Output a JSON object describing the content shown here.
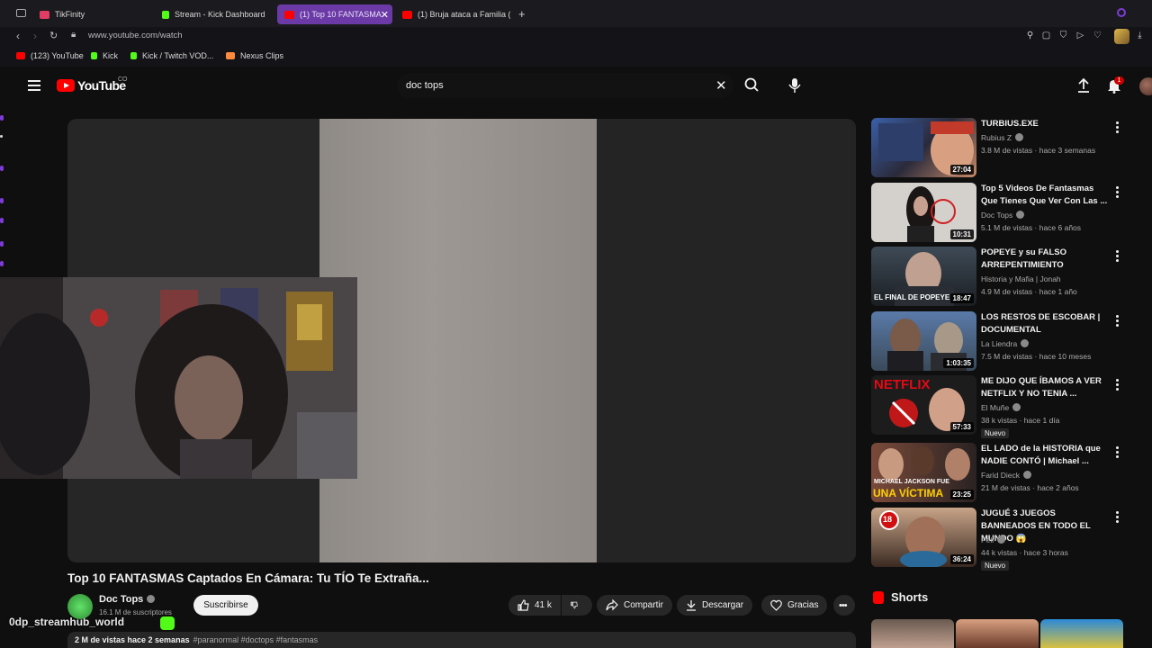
{
  "browser": {
    "tabs": [
      {
        "label": "TikFinity",
        "color": "#e03c64"
      },
      {
        "label": "Stream - Kick Dashboard",
        "color": "#53fc18"
      },
      {
        "label": "(1) Top 10 FANTASMA",
        "color": "#ff0000"
      },
      {
        "label": "(1) Bruja ataca a Familia (",
        "color": "#ff0000"
      }
    ],
    "new_tab": "+",
    "url": "www.youtube.com/watch",
    "bookmarks": [
      {
        "label": "(123) YouTube",
        "color": "#ff0000"
      },
      {
        "label": "Kick",
        "color": "#53fc18"
      },
      {
        "label": "Kick / Twitch VOD...",
        "color": "#53fc18"
      },
      {
        "label": "Nexus Clips",
        "color": "#ff8a3d"
      }
    ]
  },
  "header": {
    "logo_text": "YouTube",
    "country_code": "CO",
    "search_value": "doc tops",
    "notification_count": "1"
  },
  "video": {
    "title": "Top 10 FANTASMAS Captados En Cámara: Tu TÍO Te Extraña...",
    "channel": "Doc Tops",
    "subscribers": "16.1 M de suscriptores",
    "subscribe_label": "Suscribirse",
    "likes": "41 k",
    "share_label": "Compartir",
    "download_label": "Descargar",
    "thanks_label": "Gracias",
    "views_date": "2 M de vistas  hace 2 semanas",
    "hashtags": "#paranormal #doctops #fantasmas"
  },
  "overlay": {
    "handle": "0dp_streamhub_world"
  },
  "recommendations": [
    {
      "title": "TURBIUS.EXE",
      "channel": "Rubius Z",
      "verified": true,
      "meta": "3.8 M de vistas · hace 3 semanas",
      "duration": "27:04",
      "badge": ""
    },
    {
      "title": "Top 5 Videos De Fantasmas Que Tienes Que Ver Con Las ...",
      "channel": "Doc Tops",
      "verified": true,
      "meta": "5.1 M de vistas · hace 6 años",
      "duration": "10:31",
      "badge": ""
    },
    {
      "title": "POPEYE y su FALSO ARREPENTIMIENTO",
      "channel": "Historia y Mafia | Jonah",
      "verified": false,
      "meta": "4.9 M de vistas · hace 1 año",
      "duration": "18:47",
      "badge": "",
      "thumb_text": "EL FINAL DE POPEYE"
    },
    {
      "title": "LOS RESTOS DE ESCOBAR | DOCUMENTAL",
      "channel": "La Liendra",
      "verified": true,
      "meta": "7.5 M de vistas · hace 10 meses",
      "duration": "1:03:35",
      "badge": ""
    },
    {
      "title": "ME DIJO QUE ÍBAMOS A VER NETFLIX Y NO TENIA ...",
      "channel": "El Muñe",
      "verified": true,
      "meta": "38 k vistas · hace 1 día",
      "duration": "57:33",
      "badge": "Nuevo",
      "thumb_text": "NETFLIX"
    },
    {
      "title": "EL LADO de la HISTORIA que NADIE CONTÓ | Michael ...",
      "channel": "Farid Dieck",
      "verified": true,
      "meta": "21 M de vistas · hace 2 años",
      "duration": "23:25",
      "badge": "",
      "thumb_text": "MICHAEL JACKSON FUE",
      "thumb_text2": "UNA VÍCTIMA"
    },
    {
      "title": "JUGUÉ 3 JUEGOS BANNEADOS EN TODO EL MUNDO 😱",
      "channel": "Peli",
      "verified": true,
      "meta": "44 k vistas · hace 3 horas",
      "duration": "36:24",
      "badge": "Nuevo",
      "thumb_text": "18"
    }
  ],
  "shorts": {
    "title": "Shorts"
  }
}
